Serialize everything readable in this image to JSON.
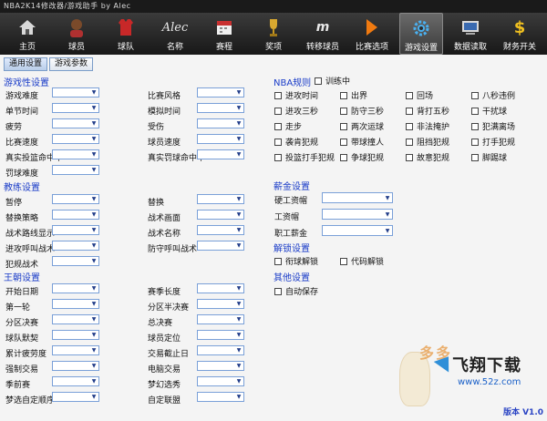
{
  "window": {
    "title": "NBA2K14修改器/游戏助手 by Alec"
  },
  "toolbar": [
    {
      "label": "主页",
      "icon": "home-icon"
    },
    {
      "label": "球员",
      "icon": "player-icon"
    },
    {
      "label": "球队",
      "icon": "jersey-icon"
    },
    {
      "label": "名称",
      "icon": "signature-icon"
    },
    {
      "label": "赛程",
      "icon": "calendar-icon"
    },
    {
      "label": "奖项",
      "icon": "trophy-icon"
    },
    {
      "label": "转移球员",
      "icon": "transfer-icon"
    },
    {
      "label": "比赛选项",
      "icon": "gatorade-icon"
    },
    {
      "label": "游戏设置",
      "icon": "gear-icon"
    },
    {
      "label": "数据读取",
      "icon": "data-icon"
    },
    {
      "label": "财务开关",
      "icon": "dollar-icon"
    }
  ],
  "subtabs": [
    "通用设置",
    "游戏参数"
  ],
  "gameplay": {
    "title": "游戏性设置",
    "left": [
      "游戏难度",
      "单节时间",
      "疲劳",
      "比赛速度",
      "真实投篮命中率",
      "罚球难度"
    ],
    "right": [
      "比赛风格",
      "模拟时间",
      "受伤",
      "球员速度",
      "真实罚球命中率"
    ]
  },
  "coach": {
    "title": "教练设置",
    "left": [
      "暂停",
      "替换策略",
      "战术路线显示",
      "进攻呼叫战术",
      "犯规战术"
    ],
    "right": [
      "替换",
      "战术画面",
      "战术名称",
      "防守呼叫战术"
    ]
  },
  "dynasty": {
    "title": "王朝设置",
    "left": [
      "开始日期",
      "第一轮",
      "分区决赛",
      "球队默契",
      "累计疲劳度",
      "强制交易",
      "季前赛",
      "梦选自定顺序"
    ],
    "right": [
      "赛季长度",
      "分区半决赛",
      "总决赛",
      "球员定位",
      "交易截止日",
      "电脑交易",
      "梦幻选秀",
      "自定联盟"
    ]
  },
  "nba_rules": {
    "title": "NBA规则",
    "training": "训练中",
    "checks": [
      [
        "进攻时间",
        "出界",
        "回场",
        "八秒违例"
      ],
      [
        "进攻三秒",
        "防守三秒",
        "背打五秒",
        "干扰球"
      ],
      [
        "走步",
        "两次运球",
        "非法掩护",
        "犯满离场"
      ],
      [
        "袭肯犯规",
        "带球撞人",
        "阻挡犯规",
        "打手犯规"
      ],
      [
        "投篮打手犯规",
        "争球犯规",
        "故意犯规",
        "脚踢球"
      ]
    ]
  },
  "salary": {
    "title": "薪金设置",
    "fields": [
      "硬工资帽",
      "工资帽",
      "职工薪金"
    ]
  },
  "unlock": {
    "title": "解锁设置",
    "checks": [
      "衔球解锁",
      "代码解锁"
    ]
  },
  "other": {
    "title": "其他设置",
    "checks": [
      "自动保存"
    ]
  },
  "version": "版本 V1.0",
  "watermark": {
    "brand": "飞翔下载",
    "url": "www.52z.com",
    "mark": "多多"
  }
}
